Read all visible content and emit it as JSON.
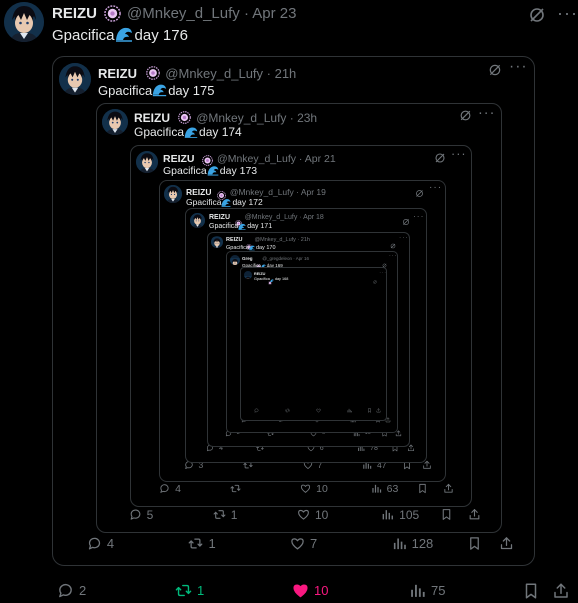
{
  "tweet": {
    "author_name": "REIZU",
    "handle_time": "@Mnkey_d_Lufy · Apr 23",
    "text": "Gpacifica",
    "wave": "🌊",
    "day": "day 176",
    "actions": {
      "replies": "2",
      "reposts": "1",
      "likes": "10",
      "views": "75"
    }
  },
  "quotes": [
    {
      "name": "REIZU",
      "handle_time": "@Mnkey_d_Lufy · 21h",
      "text": "Gpacifica",
      "day": "day 175",
      "replies": "4",
      "reposts": "1",
      "likes": "7",
      "views": "128"
    },
    {
      "name": "REIZU",
      "handle_time": "@Mnkey_d_Lufy · 23h",
      "text": "Gpacifica",
      "day": "day 174",
      "replies": "5",
      "reposts": "1",
      "likes": "10",
      "views": "105"
    },
    {
      "name": "REIZU",
      "handle_time": "@Mnkey_d_Lufy · Apr 21",
      "text": "Gpacifica",
      "day": "day 173",
      "replies": "4",
      "reposts": "",
      "likes": "10",
      "views": "63"
    },
    {
      "name": "REIZU",
      "handle_time": "@Mnkey_d_Lufy · Apr 19",
      "text": "Gpacifica",
      "day": "day 172",
      "replies": "3",
      "reposts": "",
      "likes": "7",
      "views": "47"
    },
    {
      "name": "REIZU",
      "handle_time": "@Mnkey_d_Lufy · Apr 18",
      "text": "Gpacifica",
      "day": "day 171",
      "replies": "4",
      "reposts": "",
      "likes": "6",
      "views": "78"
    },
    {
      "name": "REIZU",
      "handle_time": "@Mnkey_d_Lufy · 21h",
      "text": "Gpacifica",
      "day": "day 170",
      "replies": "3",
      "reposts": "",
      "likes": "6",
      "views": "16"
    },
    {
      "name": "Greg",
      "handle_time": "@_gregdeleon · Apr 16",
      "text": "Gpacifica",
      "day": "day 169",
      "replies": "",
      "reposts": "",
      "likes": "",
      "views": ""
    },
    {
      "name": "REIZU",
      "handle_time": "",
      "text": "Gpacifica",
      "day": "day 168",
      "replies": "",
      "reposts": "",
      "likes": "",
      "views": ""
    }
  ],
  "colors": {
    "background": "#000000",
    "border": "#2f3336",
    "muted": "#71767b",
    "text": "#e7e9ea",
    "repost_active": "#00ba7c",
    "like_active": "#f91880",
    "verified_badge": "#c9a0d8"
  },
  "icons": {
    "reply": "reply-icon",
    "repost": "repost-icon",
    "like": "heart-icon",
    "views": "views-icon",
    "bookmark": "bookmark-icon",
    "share": "share-icon",
    "grok": "grok-icon",
    "more": "more-icon"
  }
}
